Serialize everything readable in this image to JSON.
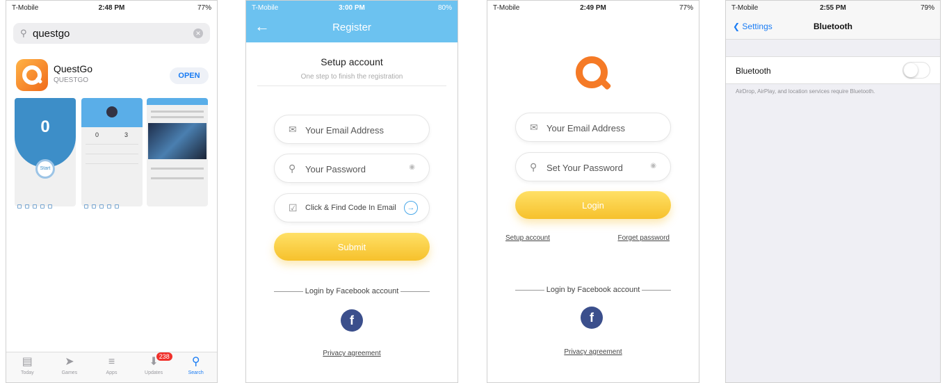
{
  "phone1": {
    "status": {
      "carrier": "T-Mobile",
      "time": "2:48 PM",
      "battery": "77%"
    },
    "search_value": "questgo",
    "app_name": "QuestGo",
    "app_developer": "QUESTGO",
    "open_label": "OPEN",
    "screenshot1": {
      "counter": "0",
      "start_label": "Start"
    },
    "screenshot2": {
      "stat_a": "0",
      "stat_b": "3"
    },
    "tabs": [
      {
        "label": "Today",
        "icon": "today-icon"
      },
      {
        "label": "Games",
        "icon": "rocket-icon"
      },
      {
        "label": "Apps",
        "icon": "layers-icon"
      },
      {
        "label": "Updates",
        "icon": "download-icon",
        "badge": "238"
      },
      {
        "label": "Search",
        "icon": "search-icon"
      }
    ]
  },
  "phone2": {
    "status": {
      "carrier": "T-Mobile",
      "time": "3:00 PM",
      "battery": "80%"
    },
    "nav_title": "Register",
    "heading": "Setup account",
    "subheading": "One step to finish the registration",
    "email_placeholder": "Your Email Address",
    "password_placeholder": "Your Password",
    "code_label": "Click & Find Code In Email",
    "submit_label": "Submit",
    "facebook_label": "Login by Facebook account",
    "privacy_label": "Privacy agreement"
  },
  "phone3": {
    "status": {
      "carrier": "T-Mobile",
      "time": "2:49 PM",
      "battery": "77%"
    },
    "email_placeholder": "Your Email Address",
    "password_placeholder": "Set Your Password",
    "login_label": "Login",
    "setup_link": "Setup account",
    "forget_link": "Forget password",
    "facebook_label": "Login by Facebook account",
    "privacy_label": "Privacy agreement"
  },
  "phone4": {
    "status": {
      "carrier": "T-Mobile",
      "time": "2:55 PM",
      "battery": "79%"
    },
    "back_label": "Settings",
    "nav_title": "Bluetooth",
    "row_label": "Bluetooth",
    "footnote": "AirDrop, AirPlay, and location services require Bluetooth."
  },
  "colors": {
    "accent_blue": "#1a7cf4",
    "nav_blue": "#6cc2f0",
    "brand_orange": "#f57a26",
    "button_yellow": "#f6c12c",
    "facebook": "#3b4f8c",
    "badge_red": "#f0302a"
  }
}
